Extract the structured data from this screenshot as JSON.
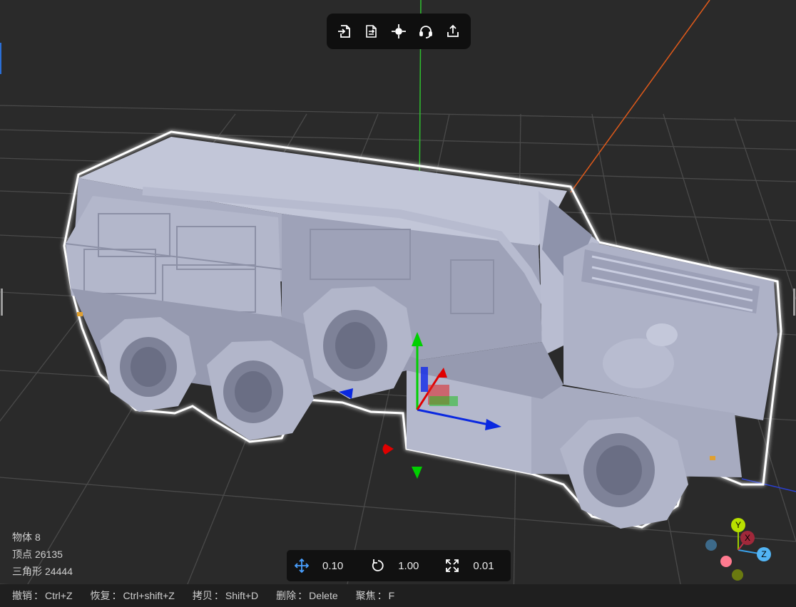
{
  "toolbar": {
    "items": [
      {
        "name": "import-icon"
      },
      {
        "name": "replace-model-icon"
      },
      {
        "name": "center-focus-icon"
      },
      {
        "name": "support-icon"
      },
      {
        "name": "export-icon"
      }
    ]
  },
  "stats": {
    "objects_label": "物体",
    "objects_value": "8",
    "vertices_label": "顶点",
    "vertices_value": "26135",
    "triangles_label": "三角形",
    "triangles_value": "24444"
  },
  "transform": {
    "translate_step": "0.10",
    "rotate_step": "1.00",
    "scale_step": "0.01"
  },
  "shortcuts": [
    {
      "label": "撤销",
      "sep": "：",
      "key": "Ctrl+Z"
    },
    {
      "label": "恢复",
      "sep": "：",
      "key": "Ctrl+shift+Z"
    },
    {
      "label": "拷贝",
      "sep": "：",
      "key": "Shift+D"
    },
    {
      "label": "删除",
      "sep": "：",
      "key": "Delete"
    },
    {
      "label": "聚焦",
      "sep": "：",
      "key": "F"
    }
  ],
  "axis_gizmo": {
    "x": "X",
    "y": "Y",
    "z": "Z"
  },
  "colors": {
    "background": "#2a2a2a",
    "grid": "#4a4a4a",
    "axis_x": "#e05a1a",
    "axis_y": "#2fbf2f",
    "axis_z": "#2a3fd0",
    "model": "#aeb2c7",
    "selection_outline": "#ffffff"
  }
}
